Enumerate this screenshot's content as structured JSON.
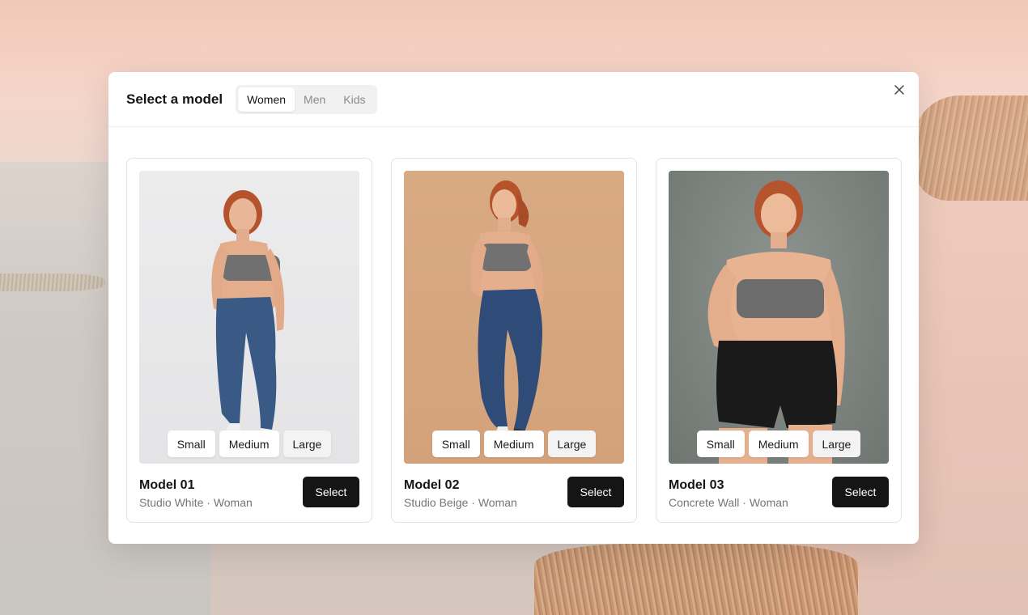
{
  "modal": {
    "title": "Select a model",
    "tabs": [
      {
        "label": "Women",
        "active": true
      },
      {
        "label": "Men",
        "active": false
      },
      {
        "label": "Kids",
        "active": false
      }
    ],
    "close_icon": "close-icon"
  },
  "size_options": [
    "Small",
    "Medium",
    "Large"
  ],
  "models": [
    {
      "name": "Model 01",
      "meta": "Studio White · Woman",
      "select_label": "Select",
      "backdrop": "#e6e6e8",
      "bottoms": "jeans"
    },
    {
      "name": "Model 02",
      "meta": "Studio Beige · Woman",
      "select_label": "Select",
      "backdrop": "#d6a77f",
      "bottoms": "jeans"
    },
    {
      "name": "Model 03",
      "meta": "Concrete Wall · Woman",
      "select_label": "Select",
      "backdrop": "#7e847f",
      "bottoms": "shorts"
    }
  ],
  "colors": {
    "accent_button": "#151515",
    "hair": "#b5532c",
    "top": "#707070",
    "denim": "#2f4a74",
    "shorts": "#1a1a1a"
  }
}
